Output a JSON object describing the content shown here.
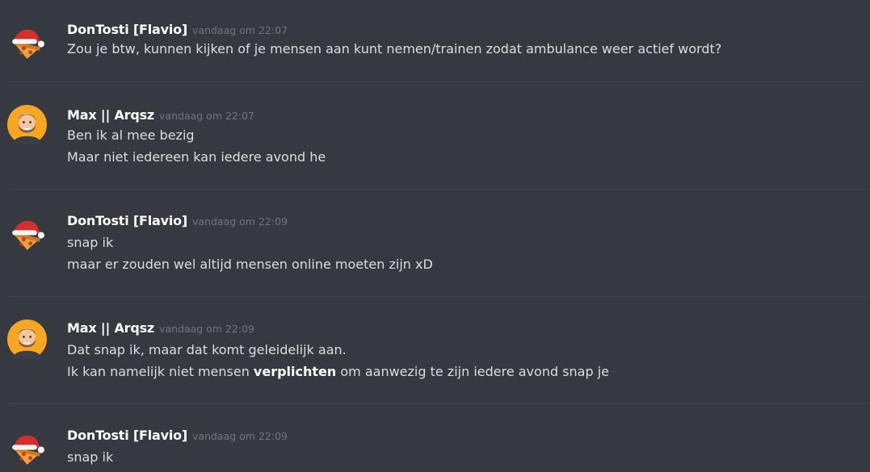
{
  "messages": [
    {
      "author": "DonTosti [Flavio]",
      "avatar_icon": "pizza-santa-hat-icon",
      "timestamp": "vandaag om 22:07",
      "lines": [
        "Zou je btw, kunnen kijken of je mensen aan kunt nemen/trainen zodat ambulance weer actief wordt?"
      ]
    },
    {
      "author": "Max || Arqsz",
      "avatar_icon": "bearded-man-avatar-icon",
      "timestamp": "vandaag om 22:07",
      "lines": [
        "Ben ik al mee bezig",
        "Maar niet iedereen kan iedere avond he"
      ]
    },
    {
      "author": "DonTosti [Flavio]",
      "avatar_icon": "pizza-santa-hat-icon",
      "timestamp": "vandaag om 22:09",
      "lines": [
        "snap ik",
        "maar er zouden wel altijd mensen online moeten zijn xD"
      ]
    },
    {
      "author": "Max || Arqsz",
      "avatar_icon": "bearded-man-avatar-icon",
      "timestamp": "vandaag om 22:09",
      "lines": [
        "Dat snap ik, maar dat komt geleidelijk aan."
      ],
      "rich_line": {
        "before": "Ik kan namelijk niet mensen ",
        "bold": "verplichten",
        "after": " om aanwezig te zijn iedere avond snap je"
      }
    },
    {
      "author": "DonTosti [Flavio]",
      "avatar_icon": "pizza-santa-hat-icon",
      "timestamp": "vandaag om 22:09",
      "lines": [
        "snap ik"
      ]
    }
  ],
  "colors": {
    "background": "#36393f",
    "username": "#ffffff",
    "message_text": "#dcddde",
    "timestamp": "#72767d",
    "divider": "#42454a"
  }
}
